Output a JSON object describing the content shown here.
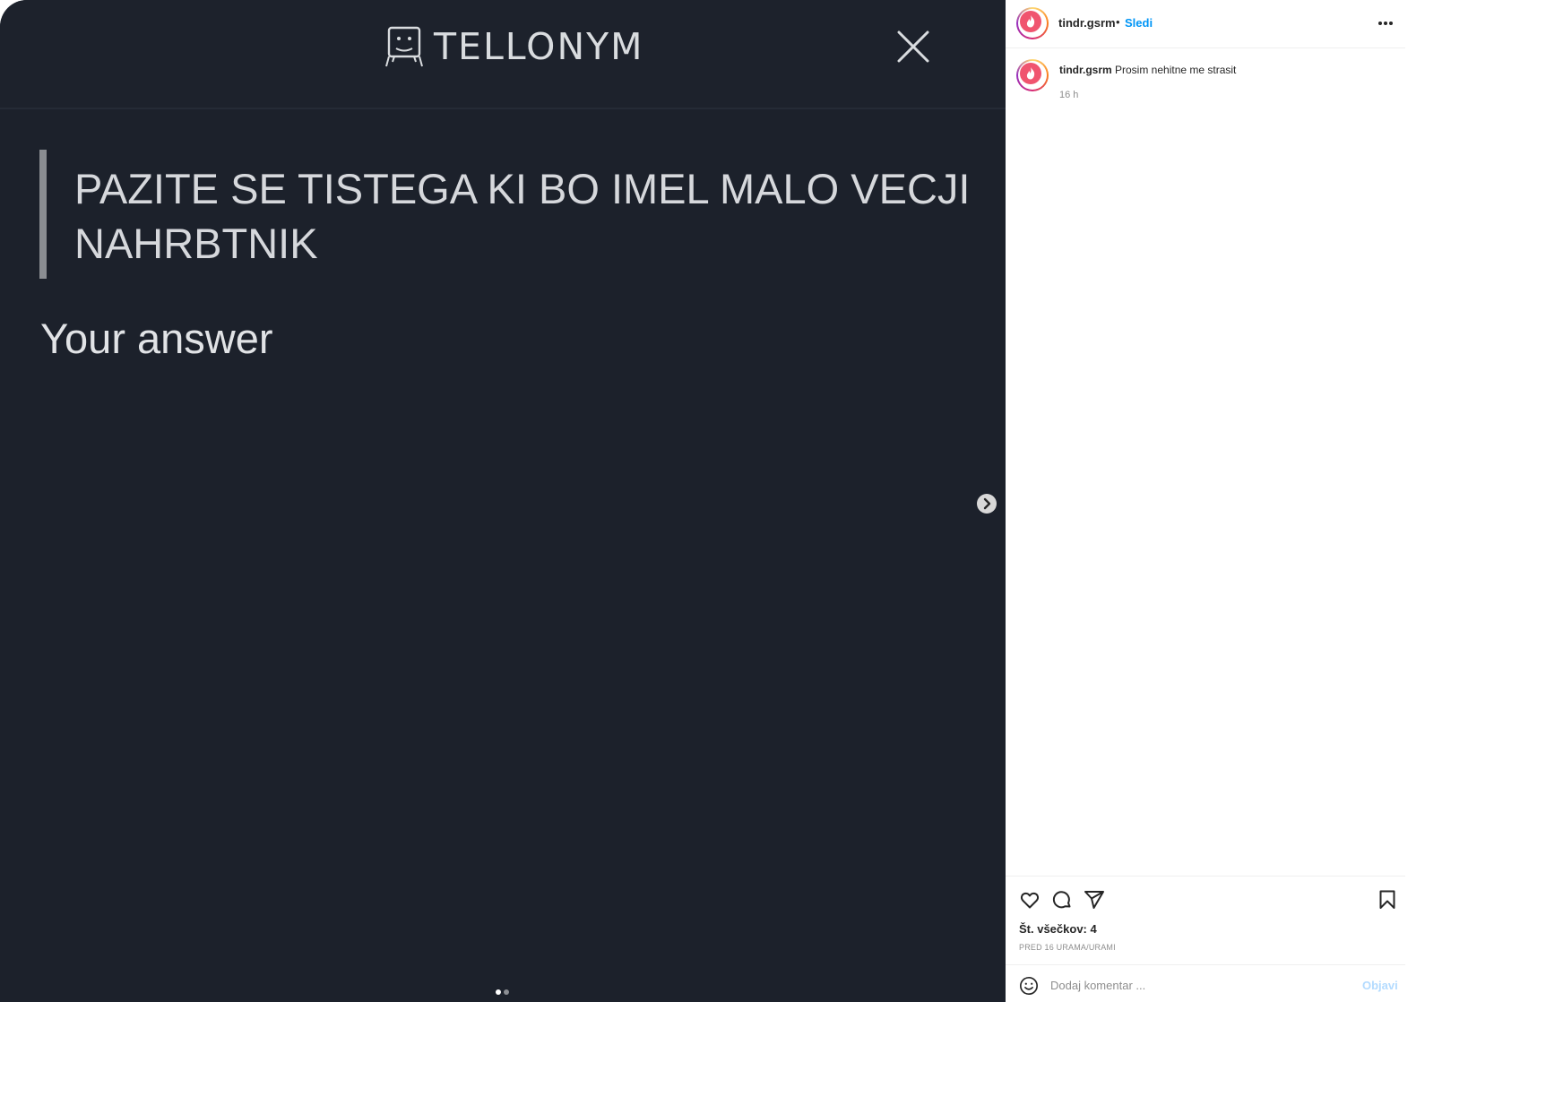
{
  "media": {
    "brand": "TELLONYM",
    "question": "PAZITE SE TISTEGA KI BO IMEL MALO VECJI NAHRBTNIK",
    "answer_label": "Your answer",
    "carousel": {
      "count": 2,
      "active_index": 0
    }
  },
  "post": {
    "header": {
      "username": "tindr.gsrm",
      "separator": "•",
      "follow_label": "Sledi"
    },
    "caption": {
      "username": "tindr.gsrm",
      "text": "Prosim nehitne me strasit",
      "time": "16 h"
    },
    "likes_label": "Št. všečkov: 4",
    "posted_ago": "PRED 16 URAMA/URAMI",
    "comment": {
      "placeholder": "Dodaj komentar ...",
      "post_label": "Objavi"
    }
  },
  "colors": {
    "media_background": "#1c212b",
    "accent_blue": "#0095f6",
    "post_button_disabled": "#b3dbff",
    "avatar_brand": "#f0546f"
  },
  "icons": {
    "tellonym_logo": "tellonym-logo-icon",
    "close": "close-icon",
    "next": "chevron-right-icon",
    "like": "heart-icon",
    "comment": "comment-bubble-icon",
    "share": "paper-plane-icon",
    "save": "bookmark-icon",
    "emoji": "emoji-smile-icon",
    "more": "more-horizontal-icon"
  }
}
